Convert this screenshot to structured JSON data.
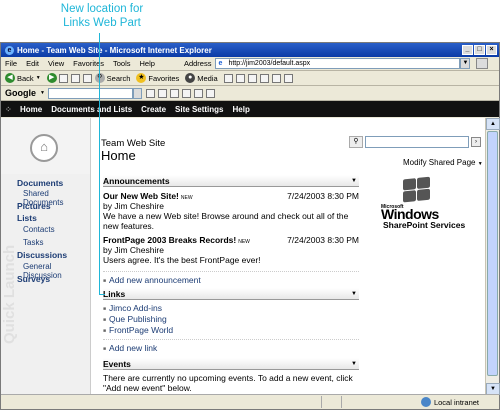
{
  "callout": {
    "text": "New location for Links Web Part"
  },
  "window": {
    "title": "Home - Team Web Site - Microsoft Internet Explorer"
  },
  "menubar": {
    "items": [
      "File",
      "Edit",
      "View",
      "Favorites",
      "Tools",
      "Help"
    ]
  },
  "address": {
    "label": "Address",
    "url": "http://jim2003/default.aspx"
  },
  "toolbar": {
    "back": "Back",
    "search": "Search",
    "favorites": "Favorites",
    "media": "Media"
  },
  "googlebar": {
    "logo": "Google"
  },
  "sp_nav": {
    "items": [
      "Home",
      "Documents and Lists",
      "Create",
      "Site Settings",
      "Help"
    ]
  },
  "site": {
    "name": "Team Web Site",
    "page_title": "Home",
    "modify_label": "Modify Shared Page"
  },
  "quicklaunch": {
    "watermark": "Quick Launch",
    "items": [
      {
        "label": "Documents",
        "level": "head"
      },
      {
        "label": "Shared Documents",
        "level": "sub"
      },
      {
        "label": "Pictures",
        "level": "head"
      },
      {
        "label": "Lists",
        "level": "head"
      },
      {
        "label": "Contacts",
        "level": "sub"
      },
      {
        "label": "Tasks",
        "level": "sub"
      },
      {
        "label": "Discussions",
        "level": "head"
      },
      {
        "label": "General Discussion",
        "level": "sub"
      },
      {
        "label": "Surveys",
        "level": "head"
      }
    ]
  },
  "announcements": {
    "title": "Announcements",
    "items": [
      {
        "title": "Our New Web Site!",
        "badge": "NEW",
        "date": "7/24/2003 8:30 PM",
        "author": "by Jim Cheshire",
        "body_line1": "We have a new Web site!  Browse around and check out all of the",
        "body_line2": "new features."
      },
      {
        "title": "FrontPage 2003 Breaks Records!",
        "badge": "NEW",
        "date": "7/24/2003 8:30 PM",
        "author": "by Jim Cheshire",
        "body_line1": "Users agree.  It's the best FrontPage ever!"
      }
    ],
    "add_label": "Add new announcement"
  },
  "links": {
    "title": "Links",
    "items": [
      "Jimco Add-ins",
      "Que Publishing",
      "FrontPage World"
    ],
    "add_label": "Add new link"
  },
  "events": {
    "title": "Events",
    "message_line1": "There are currently no upcoming events. To add a new event, click",
    "message_line2": "\"Add new event\" below."
  },
  "logo": {
    "ms": "Microsoft",
    "windows": "Windows",
    "sps": "SharePoint Services"
  },
  "statusbar": {
    "zone": "Local intranet"
  }
}
